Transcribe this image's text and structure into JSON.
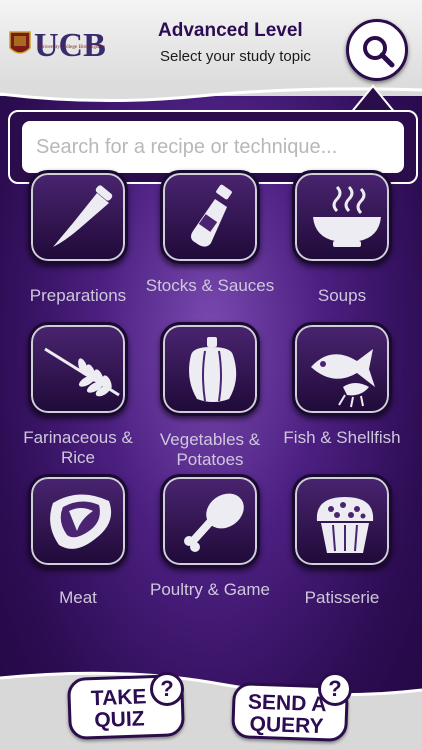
{
  "header": {
    "logo_text": "UCB",
    "logo_subtext": "University College Birmingham",
    "title": "Advanced Level",
    "subtitle": "Select your study topic"
  },
  "search": {
    "placeholder": "Search for a recipe or technique..."
  },
  "topics": [
    {
      "label": "Preparations",
      "icon": "knife-icon"
    },
    {
      "label": "Stocks & Sauces",
      "icon": "bottle-icon"
    },
    {
      "label": "Soups",
      "icon": "soup-bowl-icon"
    },
    {
      "label": "Farinaceous & Rice",
      "icon": "wheat-icon"
    },
    {
      "label": "Vegetables & Potatoes",
      "icon": "pepper-icon"
    },
    {
      "label": "Fish & Shellfish",
      "icon": "fish-icon"
    },
    {
      "label": "Meat",
      "icon": "steak-icon"
    },
    {
      "label": "Poultry & Game",
      "icon": "drumstick-icon"
    },
    {
      "label": "Patisserie",
      "icon": "muffin-icon"
    }
  ],
  "footer": {
    "quiz_label_1": "TAKE",
    "quiz_label_2": "QUIZ",
    "query_label_1": "SEND A",
    "query_label_2": "QUERY",
    "question_mark": "?"
  },
  "colors": {
    "brand_purple": "#2c0c52",
    "tile_label": "#cfc8dc"
  }
}
